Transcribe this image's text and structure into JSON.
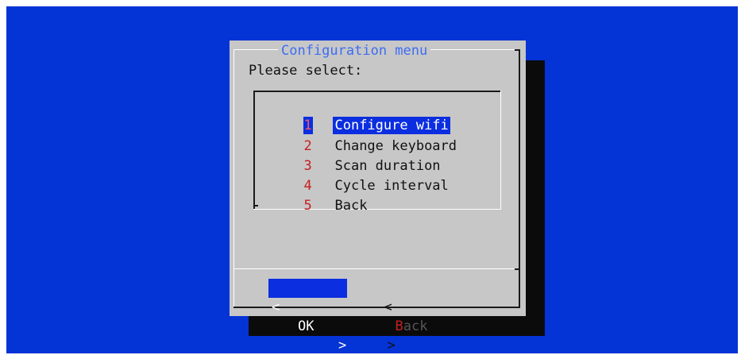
{
  "dialog": {
    "title": "Configuration menu",
    "prompt": "Please select:"
  },
  "menu": {
    "selected_index": 0,
    "items": [
      {
        "tag": "1",
        "label": "Configure wifi"
      },
      {
        "tag": "2",
        "label": "Change keyboard"
      },
      {
        "tag": "3",
        "label": "Scan duration"
      },
      {
        "tag": "4",
        "label": "Cycle interval"
      },
      {
        "tag": "5",
        "label": "Back"
      }
    ]
  },
  "buttons": {
    "ok": {
      "left": "<",
      "label": "OK",
      "right": ">"
    },
    "back": {
      "left": "<",
      "hotkey": "B",
      "rest": "ack",
      "right": ">"
    }
  },
  "colors": {
    "background": "#0433d6",
    "dialog": "#c7c7c7",
    "shadow": "#0b0b0b",
    "title": "#3d6df2",
    "highlight": "#0b2ee0",
    "tag": "#c62020"
  }
}
